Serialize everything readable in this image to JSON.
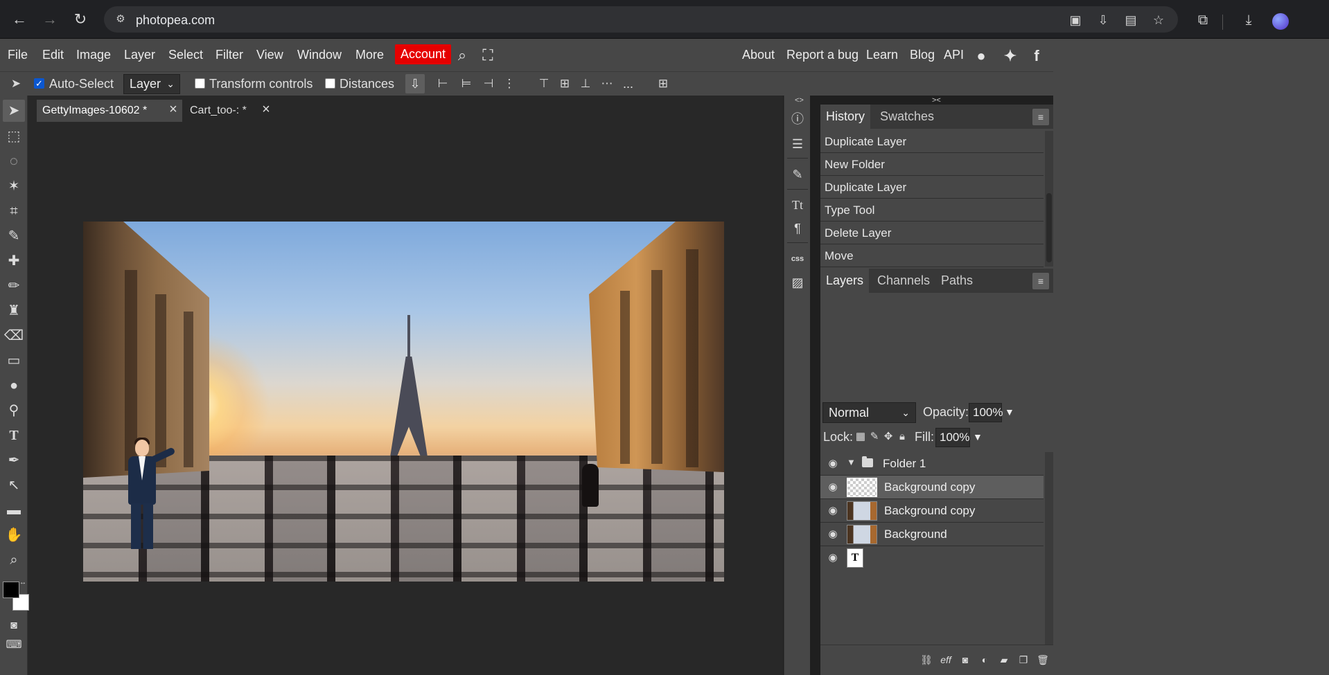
{
  "browser": {
    "url": "photopea.com",
    "icons": [
      "back-icon",
      "forward-icon",
      "reload-icon",
      "site-settings-icon",
      "clipboard-icon",
      "install-app-icon",
      "page-icon",
      "bookmark-star-icon",
      "extensions-icon",
      "download-icon",
      "profile-avatar"
    ]
  },
  "menu": {
    "items": [
      "File",
      "Edit",
      "Image",
      "Layer",
      "Select",
      "Filter",
      "View",
      "Window",
      "More"
    ],
    "account": "Account",
    "right_links": [
      "About",
      "Report a bug",
      "Learn",
      "Blog",
      "API"
    ],
    "account_color": "#e50000"
  },
  "options": {
    "auto_select_label": "Auto-Select",
    "auto_select_checked": true,
    "target": "Layer",
    "transform_controls_label": "Transform controls",
    "distances_label": "Distances",
    "more": "..."
  },
  "tabs": [
    {
      "label": "GettyImages-10602 *",
      "active": true
    },
    {
      "label": "Cart_too-: *",
      "active": false
    }
  ],
  "dock": {
    "collapse_left": "<>",
    "collapse_right": "><",
    "css_label": "css"
  },
  "history": {
    "tabs": [
      "History",
      "Swatches"
    ],
    "items": [
      "Duplicate Layer",
      "New Folder",
      "Duplicate Layer",
      "Type Tool",
      "Delete Layer",
      "Move"
    ]
  },
  "layers": {
    "tabs": [
      "Layers",
      "Channels",
      "Paths"
    ],
    "blend_mode": "Normal",
    "opacity_label": "Opacity:",
    "opacity": "100%",
    "lock_label": "Lock:",
    "fill_label": "Fill:",
    "fill": "100%",
    "folder": "Folder 1",
    "rows": [
      {
        "name": "Background copy",
        "thumb": "transparent",
        "selected": true
      },
      {
        "name": "Background copy",
        "thumb": "photo",
        "selected": false
      },
      {
        "name": "Background",
        "thumb": "photo",
        "selected": false
      }
    ],
    "text_layer_thumb": "T",
    "footer_icons": [
      "link-layers-icon",
      "layer-effects-icon",
      "layer-mask-icon",
      "adjustment-layer-icon",
      "new-folder-icon",
      "new-layer-icon",
      "delete-layer-icon"
    ],
    "footer_effects_label": "eff"
  },
  "colors": {
    "foreground": "#000000",
    "background": "#ffffff",
    "panel_bg": "#474747",
    "workspace_bg": "#282828"
  }
}
